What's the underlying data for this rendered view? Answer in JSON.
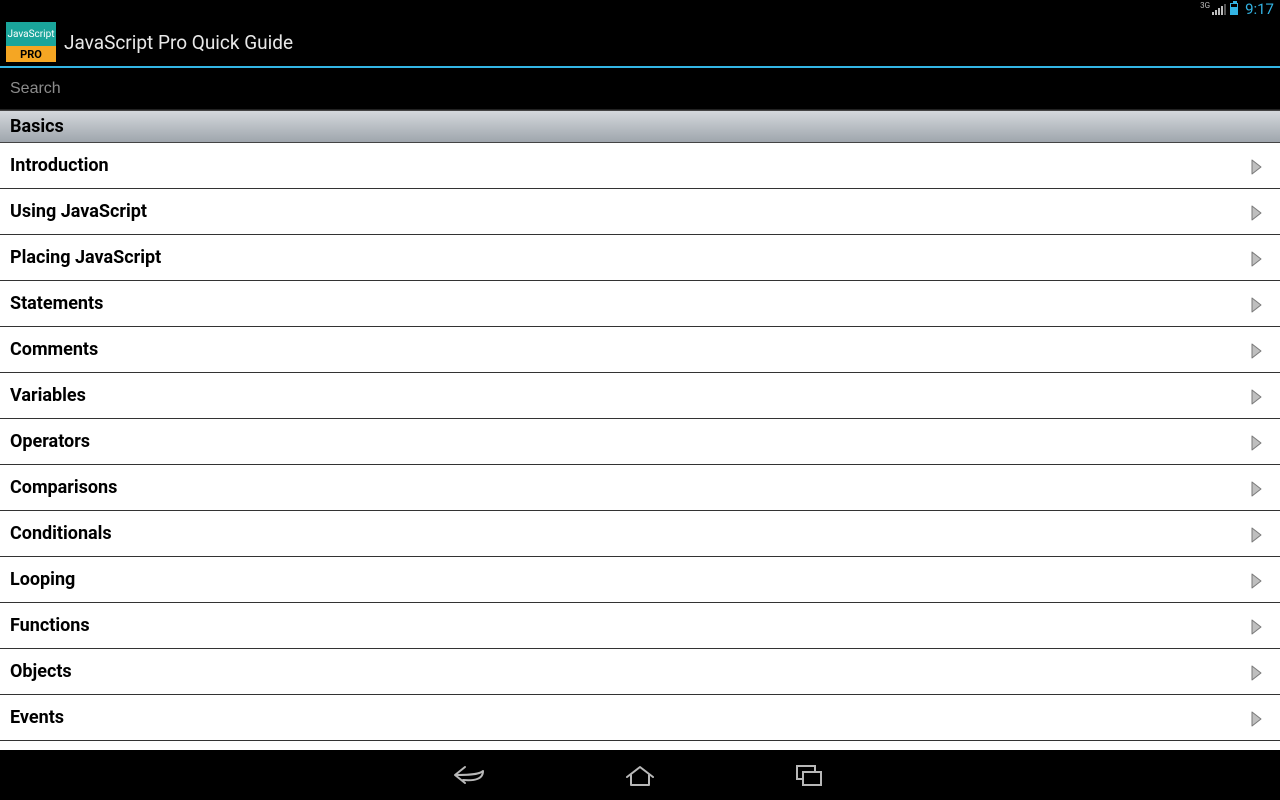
{
  "status": {
    "network_label": "3G",
    "clock": "9:17"
  },
  "header": {
    "icon_top": "JavaScript",
    "icon_bottom": "PRO",
    "title": "JavaScript Pro Quick Guide"
  },
  "search": {
    "placeholder": "Search"
  },
  "section": {
    "title": "Basics"
  },
  "topics": [
    "Introduction",
    "Using JavaScript",
    "Placing JavaScript",
    "Statements",
    "Comments",
    "Variables",
    "Operators",
    "Comparisons",
    "Conditionals",
    "Looping",
    "Functions",
    "Objects",
    "Events"
  ]
}
